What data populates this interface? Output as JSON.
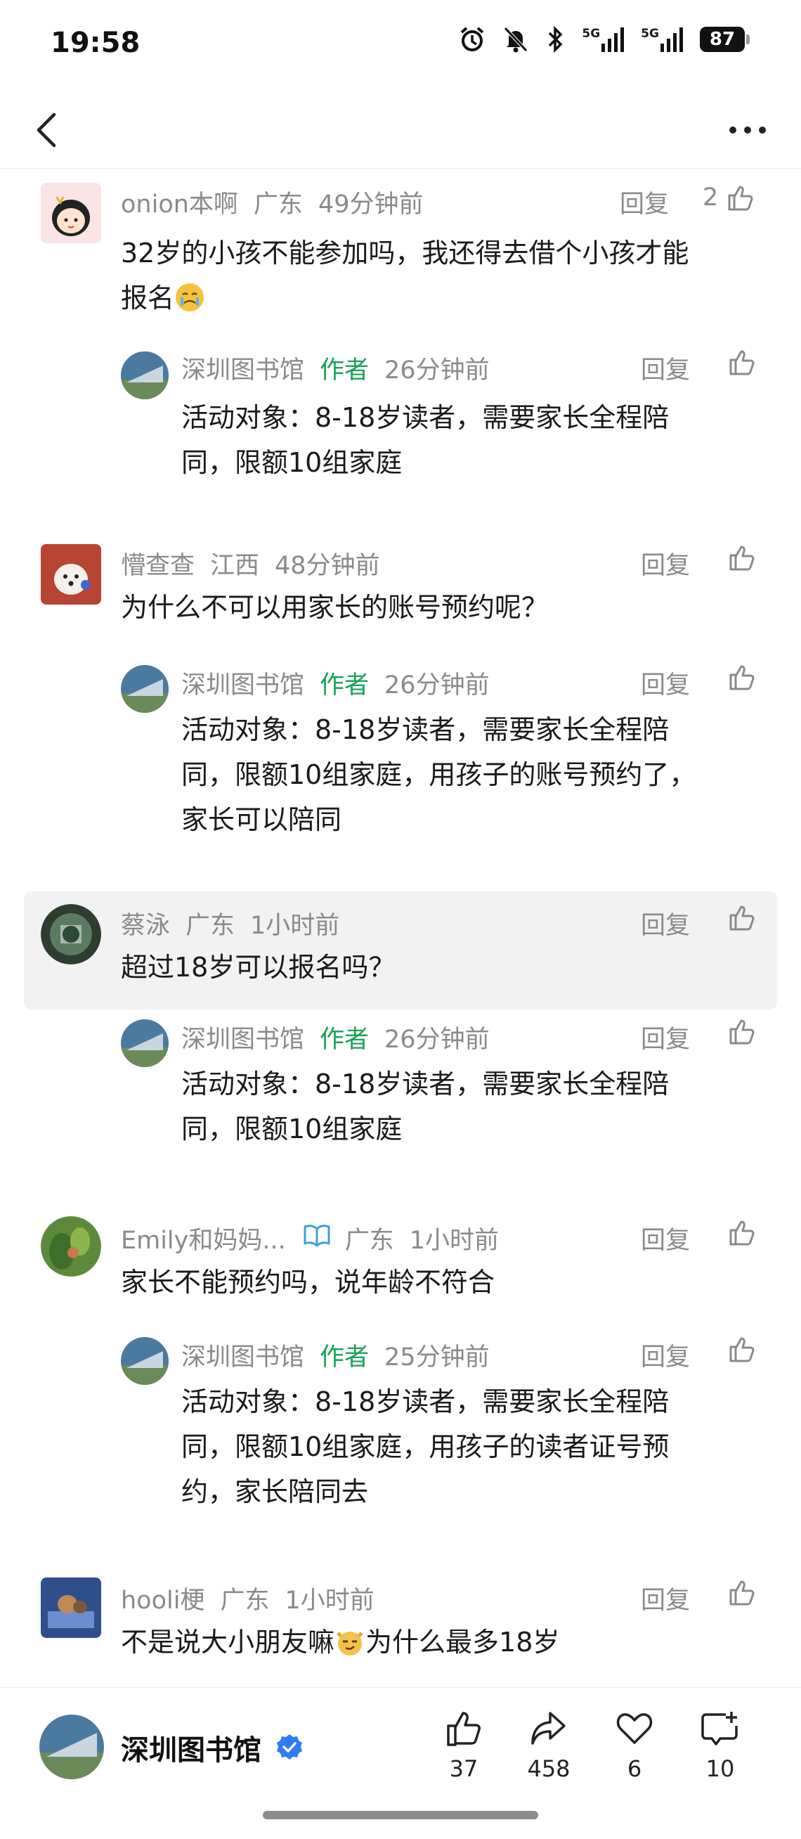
{
  "status_bar": {
    "time": "19:58",
    "battery": "87",
    "network_1": "5G",
    "network_2": "5G"
  },
  "nav": {
    "back_icon": "chevron-left-icon",
    "more_icon": "more-dots-icon"
  },
  "reply_label": "回复",
  "author_tag": "作者",
  "comments": [
    {
      "user": "onion本啊",
      "region": "广东",
      "time": "49分钟前",
      "likes": "2",
      "text_line1": "32岁的小孩不能参加吗，我还得去借个小孩才能",
      "text_line2": "报名",
      "reply": {
        "user": "深圳图书馆",
        "time": "26分钟前",
        "lines": [
          "活动对象：8-18岁读者，需要家长全程陪",
          "同，限额10组家庭"
        ]
      }
    },
    {
      "user": "懵查查",
      "region": "江西",
      "time": "48分钟前",
      "likes": "",
      "text_line1": "为什么不可以用家长的账号预约呢？",
      "reply": {
        "user": "深圳图书馆",
        "time": "26分钟前",
        "lines": [
          "活动对象：8-18岁读者，需要家长全程陪",
          "同，限额10组家庭，用孩子的账号预约了，",
          "家长可以陪同"
        ]
      }
    },
    {
      "user": "蔡泳",
      "region": "广东",
      "time": "1小时前",
      "likes": "",
      "text_line1": "超过18岁可以报名吗？",
      "reply": {
        "user": "深圳图书馆",
        "time": "26分钟前",
        "lines": [
          "活动对象：8-18岁读者，需要家长全程陪",
          "同，限额10组家庭"
        ]
      }
    },
    {
      "user": "Emily和妈妈...",
      "region": "广东",
      "time": "1小时前",
      "likes": "",
      "text_line1": "家长不能预约吗，说年龄不符合",
      "reply": {
        "user": "深圳图书馆",
        "time": "25分钟前",
        "lines": [
          "活动对象：8-18岁读者，需要家长全程陪",
          "同，限额10组家庭，用孩子的读者证号预",
          "约，家长陪同去"
        ]
      }
    },
    {
      "user": "hooli梗",
      "region": "广东",
      "time": "1小时前",
      "likes": "",
      "text_before": "不是说大小朋友嘛",
      "text_after": "为什么最多18岁"
    }
  ],
  "bottom_bar": {
    "account_name": "深圳图书馆",
    "likes": "37",
    "shares": "458",
    "favorites": "6",
    "comments": "10"
  },
  "colors": {
    "author_green": "#1aa155",
    "meta_gray": "#8a8a8a",
    "verified_blue": "#2f7cf6",
    "highlight_bg": "#f2f2f2"
  }
}
